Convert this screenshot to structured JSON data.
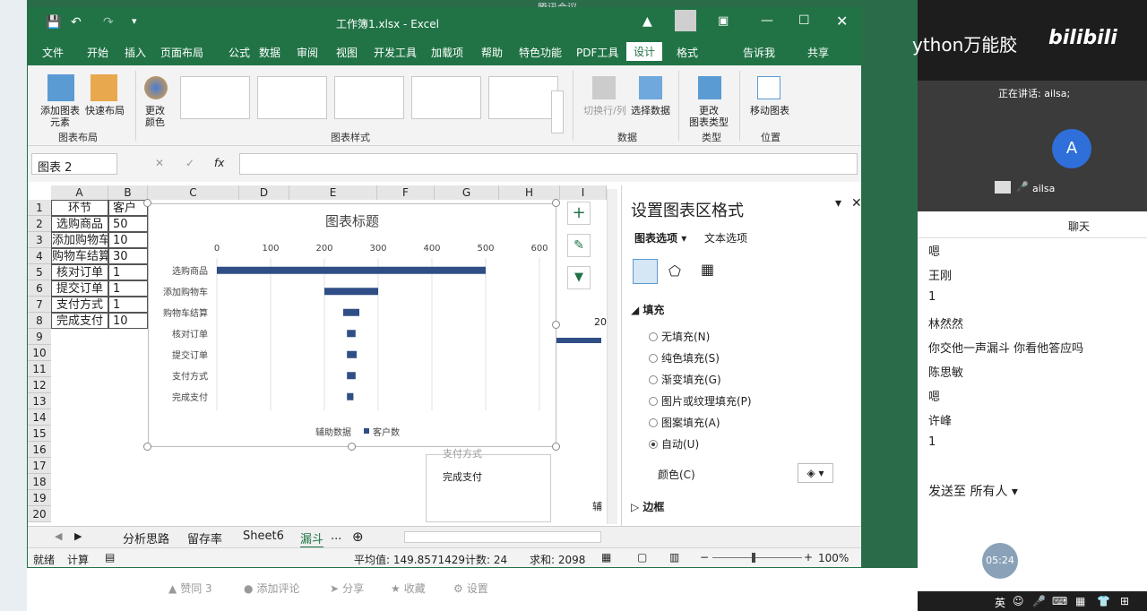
{
  "taskbar": {
    "meeting_title": "腾讯会议"
  },
  "window": {
    "title": "工作簿1.xlsx  -  Excel",
    "share": "共享",
    "tell_me": "告诉我"
  },
  "menu": [
    "文件",
    "开始",
    "插入",
    "页面布局",
    "公式",
    "数据",
    "审阅",
    "视图",
    "开发工具",
    "加载项",
    "帮助",
    "特色功能",
    "PDF工具",
    "设计",
    "格式"
  ],
  "ribbon": {
    "add_element": "添加图表\n元素",
    "quick_layout": "快速布局",
    "change_color": "更改\n颜色",
    "switch_row_col": "切换行/列",
    "select_data": "选择数据",
    "change_type": "更改\n图表类型",
    "move_chart": "移动图表",
    "groups": {
      "layout": "图表布局",
      "styles": "图表样式",
      "data": "数据",
      "type": "类型",
      "location": "位置"
    }
  },
  "formula_bar": {
    "name_box": "图表 2",
    "fx": "fx",
    "value": ""
  },
  "columns": [
    "A",
    "B",
    "C",
    "D",
    "E",
    "F",
    "G",
    "H",
    "I"
  ],
  "rows": [
    "1",
    "2",
    "3",
    "4",
    "5",
    "6",
    "7",
    "8",
    "9",
    "10",
    "11",
    "12",
    "13",
    "14",
    "15",
    "16",
    "17",
    "18",
    "19",
    "20"
  ],
  "table": {
    "header": [
      "环节",
      "客户"
    ],
    "rows": [
      [
        "选购商品",
        "50"
      ],
      [
        "添加购物车",
        "10"
      ],
      [
        "购物车结算",
        "30"
      ],
      [
        "核对订单",
        "1"
      ],
      [
        "提交订单",
        "1"
      ],
      [
        "支付方式",
        "1"
      ],
      [
        "完成支付",
        "10"
      ]
    ]
  },
  "chart_data": {
    "type": "bar",
    "title": "图表标题",
    "categories": [
      "选购商品",
      "添加购物车",
      "购物车结算",
      "核对订单",
      "提交订单",
      "支付方式",
      "完成支付"
    ],
    "series": [
      {
        "name": "辅助数据",
        "values": [
          0,
          200,
          235,
          242,
          242,
          242,
          242
        ]
      },
      {
        "name": "客户数",
        "values": [
          500,
          100,
          30,
          16,
          18,
          16,
          12
        ]
      }
    ],
    "xticks": [
      "0",
      "100",
      "200",
      "300",
      "400",
      "500",
      "600"
    ],
    "xlim": [
      0,
      600
    ],
    "legend": "bottom",
    "color": "#2f4e86"
  },
  "behind_chart": {
    "label1": "支付方式",
    "label2": "完成支付",
    "text1": "20",
    "text2": "辅"
  },
  "sheet_tabs": [
    "分析思路",
    "留存率",
    "Sheet6",
    "漏斗",
    "..."
  ],
  "status": {
    "ready": "就绪",
    "calc": "计算",
    "avg": "平均值: 149.8571429",
    "count": "计数: 24",
    "sum": "求和: 2098",
    "zoom": "100%"
  },
  "panel": {
    "title": "设置图表区格式",
    "tab1": "图表选项",
    "tab2": "文本选项",
    "fill_section": "填充",
    "fill_options": [
      "无填充(N)",
      "纯色填充(S)",
      "渐变填充(G)",
      "图片或纹理填充(P)",
      "图案填充(A)",
      "自动(U)"
    ],
    "color_label": "颜色(C)",
    "border_section": "边框"
  },
  "web_bottom": {
    "like": "赞同 3",
    "comment": "添加评论",
    "share": "分享",
    "fav": "收藏",
    "settings": "设置"
  },
  "meeting": {
    "banner": "ython万能胶",
    "bili": "bilibili",
    "speaking": "正在讲话: ailsa;",
    "avatar": "A",
    "user": "ailsa",
    "chat_title": "聊天",
    "messages": [
      "嗯",
      "王刚",
      "1",
      "林然然",
      "你交他一声漏斗 你看他答应吗",
      "陈思敏",
      "嗯",
      "许峰",
      "1"
    ],
    "send_to": "发送至 所有人",
    "timer": "05:24",
    "ime": "英"
  }
}
